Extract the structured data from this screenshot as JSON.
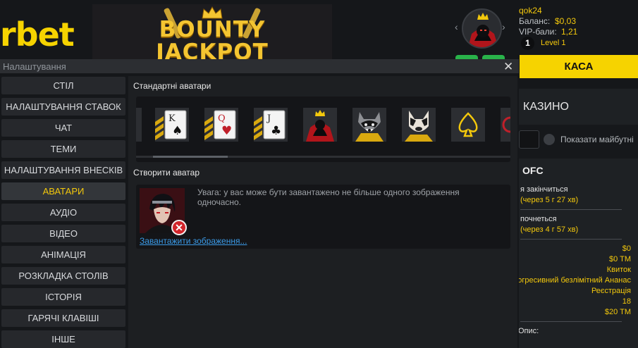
{
  "header": {
    "logo_text": "rbet",
    "banner_line1": "BOUNTY",
    "banner_line2": "JACKPOT",
    "user": {
      "name": "qok24",
      "balance_label": "Баланс:",
      "balance_value": "$0,03",
      "vip_label": "VIP-бали:",
      "vip_value": "1,21",
      "level_number": "1",
      "level_text": "Level 1"
    },
    "cashier_label": "КАСА"
  },
  "lobby": {
    "casino_label": "КАЗИНО",
    "show_future_label": "Показати майбутні",
    "tournament": {
      "title": "OFC",
      "ends_label": "я закінчиться",
      "ends_value": "(через 5 г 27 хв)",
      "starts_label": "почнеться",
      "starts_value": "(через 4 г 57 хв)",
      "values": [
        "$0",
        "$0 TM",
        "Квиток",
        "огресивний безлімітний Ананас",
        "Реєстрація",
        "18",
        "$20 TM"
      ],
      "desc_label": "Опис:"
    }
  },
  "modal": {
    "title": "Налаштування",
    "menu": [
      {
        "label": "СТІЛ",
        "active": false
      },
      {
        "label": "НАЛАШТУВАННЯ СТАВОК",
        "active": false
      },
      {
        "label": "ЧАТ",
        "active": false
      },
      {
        "label": "ТЕМИ",
        "active": false
      },
      {
        "label": "НАЛАШТУВАННЯ ВНЕСКІВ",
        "active": false
      },
      {
        "label": "АВАТАРИ",
        "active": true
      },
      {
        "label": "АУДІО",
        "active": false
      },
      {
        "label": "ВІДЕО",
        "active": false
      },
      {
        "label": "АНІМАЦІЯ",
        "active": false
      },
      {
        "label": "РОЗКЛАДКА СТОЛІВ",
        "active": false
      },
      {
        "label": "ІСТОРІЯ",
        "active": false
      },
      {
        "label": "ГАРЯЧІ КЛАВІШІ",
        "active": false
      },
      {
        "label": "ІНШЕ",
        "active": false
      }
    ],
    "standard_avatars_title": "Стандартні аватари",
    "avatars": [
      {
        "name": "king-spade-card",
        "rank": "K",
        "suit": "♠"
      },
      {
        "name": "queen-heart-card",
        "rank": "Q",
        "suit": "♥"
      },
      {
        "name": "jack-club-card",
        "rank": "J",
        "suit": "♣"
      },
      {
        "name": "crowned-villain"
      },
      {
        "name": "raccoon"
      },
      {
        "name": "french-bulldog"
      },
      {
        "name": "gold-spade"
      }
    ],
    "create_avatar_title": "Створити аватар",
    "warning": "Увага: у вас може бути завантажено не більше одного зображення одночасно.",
    "upload_link": "Завантажити зображення..."
  },
  "colors": {
    "accent_yellow": "#f3c80c",
    "cashier_yellow": "#f6d300",
    "link_blue": "#3b9be8",
    "remove_red": "#d2252b",
    "green": "#29b34a"
  }
}
